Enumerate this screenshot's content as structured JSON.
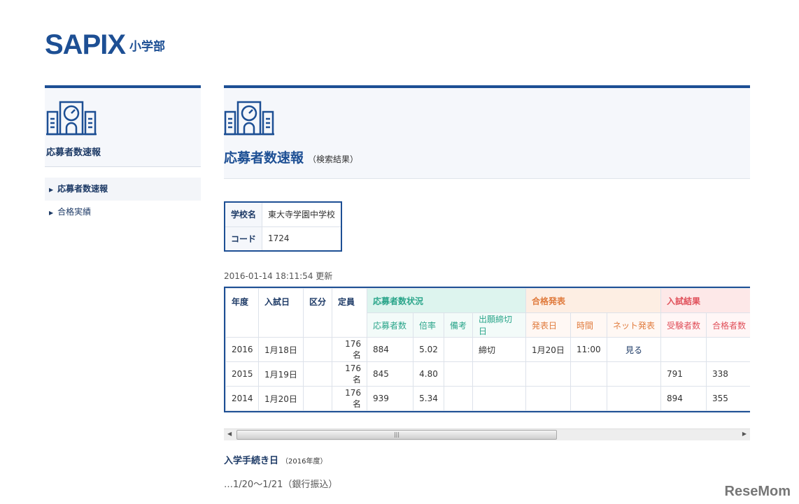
{
  "logo": {
    "brand": "SAPIX",
    "sub": "小学部"
  },
  "sidebar": {
    "title": "応募者数速報",
    "items": [
      {
        "label": "応募者数速報"
      },
      {
        "label": "合格実績"
      }
    ]
  },
  "main": {
    "title": "応募者数速報",
    "subtitle": "（検索結果）"
  },
  "school": {
    "name_label": "学校名",
    "name": "東大寺学園中学校",
    "code_label": "コード",
    "code": "1724"
  },
  "updated": "2016-01-14 18:11:54 更新",
  "table": {
    "headers": {
      "year": "年度",
      "date": "入試日",
      "kubun": "区分",
      "teiin": "定員",
      "grp1": "応募者数状況",
      "grp2": "合格発表",
      "grp3": "入試結果",
      "sub": [
        "応募者数",
        "倍率",
        "備考",
        "出願締切日",
        "発表日",
        "時間",
        "ネット発表",
        "受験者数",
        "合格者数"
      ]
    },
    "rows": [
      [
        "2016",
        "1月18日",
        "",
        "176名",
        "884",
        "5.02",
        "",
        "締切",
        "1月20日",
        "11:00",
        "見る",
        "",
        ""
      ],
      [
        "2015",
        "1月19日",
        "",
        "176名",
        "845",
        "4.80",
        "",
        "",
        "",
        "",
        "",
        "791",
        "338"
      ],
      [
        "2014",
        "1月20日",
        "",
        "176名",
        "939",
        "5.34",
        "",
        "",
        "",
        "",
        "",
        "894",
        "355"
      ]
    ]
  },
  "procedure": {
    "title": "入学手続き日",
    "year": "（2016年度）",
    "value": "…1/20～1/21（銀行振込）"
  },
  "watermark": "ReseMom"
}
